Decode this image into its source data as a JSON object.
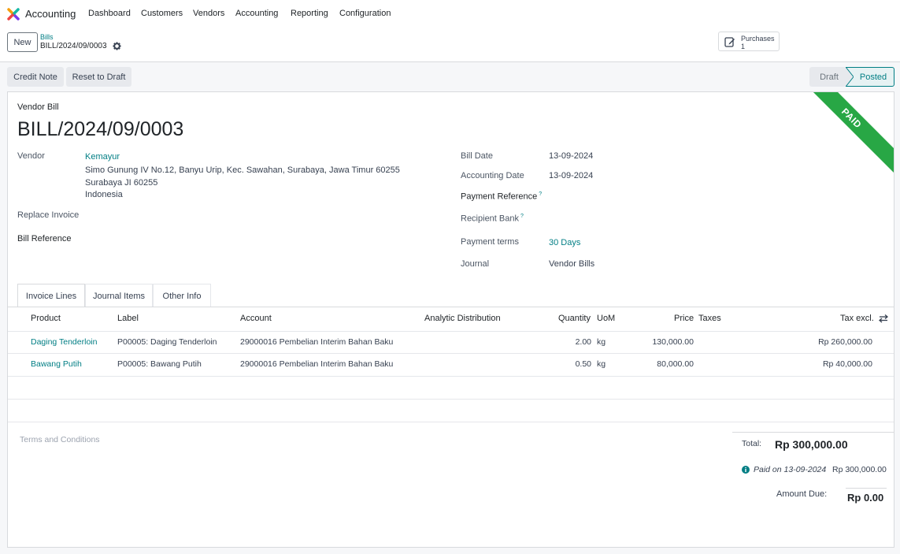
{
  "nav": {
    "app_name": "Accounting",
    "menu": [
      "Dashboard",
      "Customers",
      "Vendors",
      "Accounting",
      "Reporting",
      "Configuration"
    ]
  },
  "control": {
    "new_label": "New",
    "breadcrumb_parent": "Bills",
    "breadcrumb_current": "BILL/2024/09/0003",
    "smart_button": {
      "label": "Purchases",
      "count": "1"
    }
  },
  "actions": {
    "credit_note": "Credit Note",
    "reset_to_draft": "Reset to Draft"
  },
  "status": {
    "draft": "Draft",
    "posted": "Posted"
  },
  "ribbon": "PAID",
  "form": {
    "doc_type": "Vendor Bill",
    "title": "BILL/2024/09/0003",
    "vendor_label": "Vendor",
    "vendor_name": "Kemayur",
    "vendor_address1": "Simo Gunung IV No.12, Banyu Urip, Kec. Sawahan, Surabaya, Jawa Timur 60255",
    "vendor_address2": "Surabaya JI 60255",
    "vendor_address3": "Indonesia",
    "replace_invoice_label": "Replace Invoice",
    "bill_reference_label": "Bill Reference",
    "bill_date_label": "Bill Date",
    "bill_date": "13-09-2024",
    "accounting_date_label": "Accounting Date",
    "accounting_date": "13-09-2024",
    "payment_reference_label": "Payment Reference",
    "recipient_bank_label": "Recipient Bank",
    "help_mark": "?",
    "payment_terms_label": "Payment terms",
    "payment_terms": "30 Days",
    "journal_label": "Journal",
    "journal": "Vendor Bills"
  },
  "tabs": [
    "Invoice Lines",
    "Journal Items",
    "Other Info"
  ],
  "table": {
    "headers": {
      "product": "Product",
      "label": "Label",
      "account": "Account",
      "analytic": "Analytic Distribution",
      "quantity": "Quantity",
      "uom": "UoM",
      "price": "Price",
      "taxes": "Taxes",
      "tax_excl": "Tax excl."
    },
    "rows": [
      {
        "product": "Daging Tenderloin",
        "label": "P00005: Daging Tenderloin",
        "account": "29000016 Pembelian Interim Bahan Baku",
        "quantity": "2.00",
        "uom": "kg",
        "price": "130,000.00",
        "tax_excl": "Rp 260,000.00"
      },
      {
        "product": "Bawang Putih",
        "label": "P00005: Bawang Putih",
        "account": "29000016 Pembelian Interim Bahan Baku",
        "quantity": "0.50",
        "uom": "kg",
        "price": "80,000.00",
        "tax_excl": "Rp 40,000.00"
      }
    ]
  },
  "footer": {
    "terms_placeholder": "Terms and Conditions",
    "total_label": "Total:",
    "total_value": "Rp 300,000.00",
    "paid_on": "Paid on 13-09-2024",
    "paid_amount": "Rp 300,000.00",
    "amount_due_label": "Amount Due:",
    "amount_due": "Rp 0.00"
  },
  "colors": {
    "accent": "#017e84",
    "paid_ribbon": "#28a745"
  }
}
